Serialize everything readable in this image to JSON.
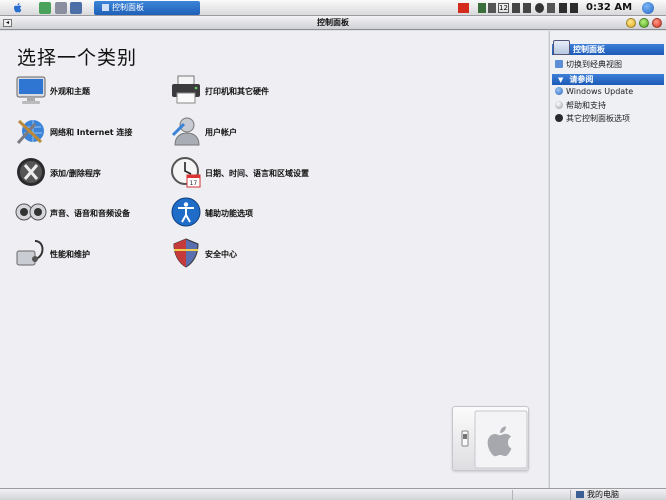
{
  "taskbar": {
    "active_task": "控制面板",
    "clock": "0:32 AM",
    "tray_text": "12"
  },
  "window": {
    "title": "控制面板"
  },
  "main": {
    "heading": "选择一个类别",
    "categories": [
      {
        "label": "外观和主题",
        "icon": "monitor-icon"
      },
      {
        "label": "打印机和其它硬件",
        "icon": "printer-icon"
      },
      {
        "label": "网络和 Internet 连接",
        "icon": "network-tools-icon"
      },
      {
        "label": "用户帐户",
        "icon": "user-accounts-icon"
      },
      {
        "label": "添加/删除程序",
        "icon": "add-remove-programs-icon"
      },
      {
        "label": "日期、时间、语言和区域设置",
        "icon": "clock-calendar-icon"
      },
      {
        "label": "声音、语音和音频设备",
        "icon": "speakers-icon"
      },
      {
        "label": "辅助功能选项",
        "icon": "accessibility-icon"
      },
      {
        "label": "性能和维护",
        "icon": "stethoscope-icon"
      },
      {
        "label": "安全中心",
        "icon": "security-shield-icon"
      }
    ]
  },
  "sidebar": {
    "panel_title": "控制面板",
    "switch_view": "切换到经典视图",
    "see_also_title": "请参阅",
    "see_also": [
      "Windows Update",
      "帮助和支持",
      "其它控制面板选项"
    ]
  },
  "statusbar": {
    "location": "我的电脑"
  },
  "colors": {
    "accent": "#1f5fb8",
    "main_bg": "#efeff3"
  }
}
